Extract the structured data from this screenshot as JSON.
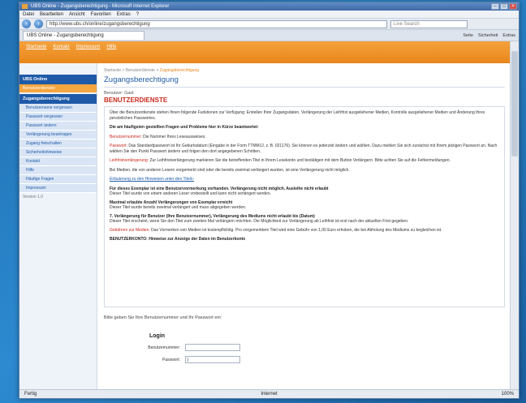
{
  "window": {
    "title": "UBS Online - Zugangsberechtigung - Microsoft Internet Explorer"
  },
  "menubar": [
    "Datei",
    "Bearbeiten",
    "Ansicht",
    "Favoriten",
    "Extras",
    "?"
  ],
  "addressbar": {
    "url": "http://www.ubs.ch/online/zugangsberechtigung",
    "search_placeholder": "Live Search"
  },
  "tab": {
    "label": "UBS Online - Zugangsberechtigung"
  },
  "commandbar": [
    "Seite",
    "Sicherheit",
    "Extras"
  ],
  "topnav": [
    "Startseite",
    "Kontakt",
    "Impressum",
    "Hilfe"
  ],
  "sidebar": {
    "header": "UBS Online",
    "active_item": "Benutzerdienste",
    "section_header": "Zugangsberechtigung",
    "items": [
      "Benutzername vergessen",
      "Passwort vergessen",
      "Passwort ändern",
      "Verlängerung beantragen",
      "Zugang freischalten",
      "Sicherheitshinweise",
      "Kontakt",
      "Hilfe",
      "Häufige Fragen",
      "Impressum"
    ],
    "footer": "Version 1.0"
  },
  "main": {
    "breadcrumb": "Startseite > Benutzerdienste >",
    "breadcrumb_current": "Zugangsberechtigung",
    "title": "Zugangsberechtigung",
    "userline": "Benutzer: Gast",
    "section_title": "BENUTZERDIENSTE",
    "intro": "Über die Benutzerdienste stehen Ihnen folgende Funktionen zur Verfügung: Erstellen Ihrer Zugangsdaten, Verlängerung der Leihfrist ausgeliehener Medien, Kontrolle ausgeliehener Medien und Änderung Ihres persönlichen Passwortes.",
    "highlight": "Die am häufigsten gestellten Fragen und Probleme hier in Kürze beantwortet:",
    "item1_label": "Benutzernummer:",
    "item1_text": "Die Nummer Ihres Leseausweises.",
    "item2_label": "Passwort:",
    "item2_text": "Das Standardpasswort ist Ihr Geburtsdatum (Eingabe in der Form TTMMJJ, z. B. 021176). Sie können es jederzeit ändern und wählen. Dazu melden Sie sich zunächst mit Ihrem jetzigen Passwort an. Nach wählen Sie den Punkt Passwort ändern und folgen den dort angegebenen Schritten.",
    "item3_label": "Leihfristverlängerung:",
    "item3_text": "Zur Leihfristverlängerung markieren Sie die betreffenden Titel in Ihrem Lesekonto und bestätigen mit dem Button Verlängern. Bitte achten Sie auf die Fehlermeldungen.",
    "note": "Bei Medien, die von anderen Lesern vorgemerkt sind oder die bereits zweimal verlängert wurden, ist eine Verlängerung nicht möglich.",
    "faq_link": "Erläuterung zu den Hinweisen unter den Titeln:",
    "faq": [
      {
        "q": "Für dieses Exemplar ist eine Benutzervormerkung vorhanden. Verlängerung nicht möglich. Ausleihe nicht erlaubt",
        "a": "Dieser Titel wurde von einem anderen Leser vorbestellt und kann nicht verlängert werden."
      },
      {
        "q": "Maximal erlaubte Anzahl Verlängerungen von Exemplar erreicht",
        "a": "Dieser Titel wurde bereits zweimal verlängert und muss abgegeben werden."
      },
      {
        "q": "7. Verlängerung für Benutzer (Ihre Benutzernummer), Verlängerung des Mediums nicht erlaubt bis (Datum)",
        "a": "Dieser Titel erscheint, wenn Sie den Titel zum zweiten Mal verlängern möchten. Die Möglichkeit zur Verlängerung ab Leihfrist ist erst nach der aktuellen Frist gegeben."
      }
    ],
    "fees_label": "Gebühren zur Medien:",
    "fees_text": "Das Vormerken von Medien ist kostenpflichtig. Pro vorgemerktem Titel wird eine Gebühr von 1,00 Euro erhoben, die bei Abholung des Mediums zu begleichen ist.",
    "truncated": "BENUTZERKONTO: Hinweise zur Anzeige der Daten im Benutzerkonto",
    "hint": "Bitte geben Sie Ihre Benutzernummer und Ihr Passwort ein:",
    "login": {
      "title": "Login",
      "user_label": "Benutzernummer:",
      "user_value": "",
      "password_label": "Passwort:",
      "password_value": "|"
    }
  },
  "statusbar": {
    "left": "Fertig",
    "zone": "Internet",
    "zoom": "100%"
  },
  "colors": {
    "accent_orange": "#e8861b",
    "brand_blue": "#1e5aa8",
    "alert_red": "#c9291c"
  }
}
